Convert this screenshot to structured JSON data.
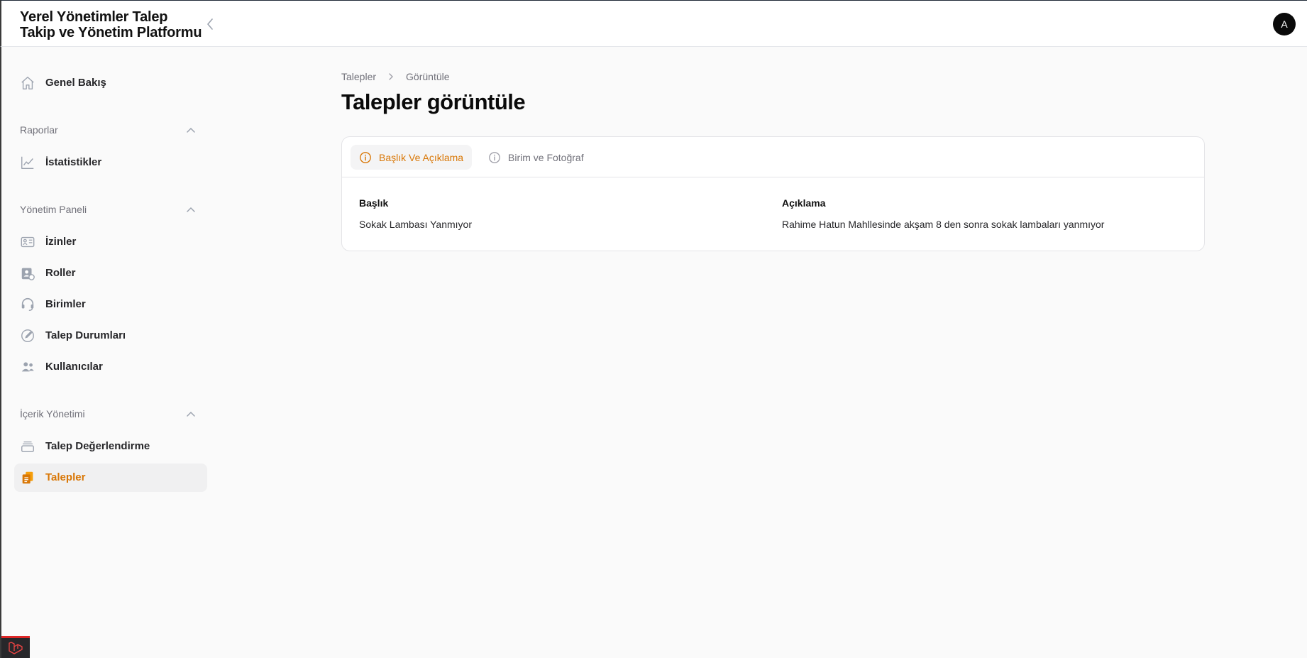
{
  "app": {
    "title_line1": "Yerel Yönetimler Talep",
    "title_line2": "Takip ve Yönetim Platformu",
    "avatar_initial": "A"
  },
  "sidebar": {
    "dashboard": {
      "label": "Genel Bakış",
      "icon": "home-icon"
    },
    "groups": [
      {
        "label": "Raporlar",
        "items": [
          {
            "label": "İstatistikler",
            "icon": "chart-line-icon"
          }
        ]
      },
      {
        "label": "Yönetim Paneli",
        "items": [
          {
            "label": "İzinler",
            "icon": "id-card-icon"
          },
          {
            "label": "Roller",
            "icon": "user-badge-icon"
          },
          {
            "label": "Birimler",
            "icon": "headset-icon"
          },
          {
            "label": "Talep Durumları",
            "icon": "pencil-circle-icon"
          },
          {
            "label": "Kullanıcılar",
            "icon": "users-icon"
          }
        ]
      },
      {
        "label": "İçerik Yönetimi",
        "items": [
          {
            "label": "Talep Değerlendirme",
            "icon": "inbox-stack-icon"
          },
          {
            "label": "Talepler",
            "icon": "clipboard-documents-icon",
            "active": true
          }
        ]
      }
    ]
  },
  "breadcrumb": [
    "Talepler",
    "Görüntüle"
  ],
  "page": {
    "title": "Talepler görüntüle"
  },
  "tabs": [
    {
      "label": "Başlık Ve Açıklama",
      "active": true
    },
    {
      "label": "Birim ve Fotoğraf",
      "active": false
    }
  ],
  "fields": [
    {
      "label": "Başlık",
      "value": "Sokak Lambası Yanmıyor"
    },
    {
      "label": "Açıklama",
      "value": "Rahime Hatun Mahllesinde akşam 8 den sonra sokak lambaları yanmıyor"
    }
  ],
  "colors": {
    "accent": "#d97706",
    "text": "#18181b",
    "muted": "#71717a",
    "border": "#e4e4e7"
  }
}
